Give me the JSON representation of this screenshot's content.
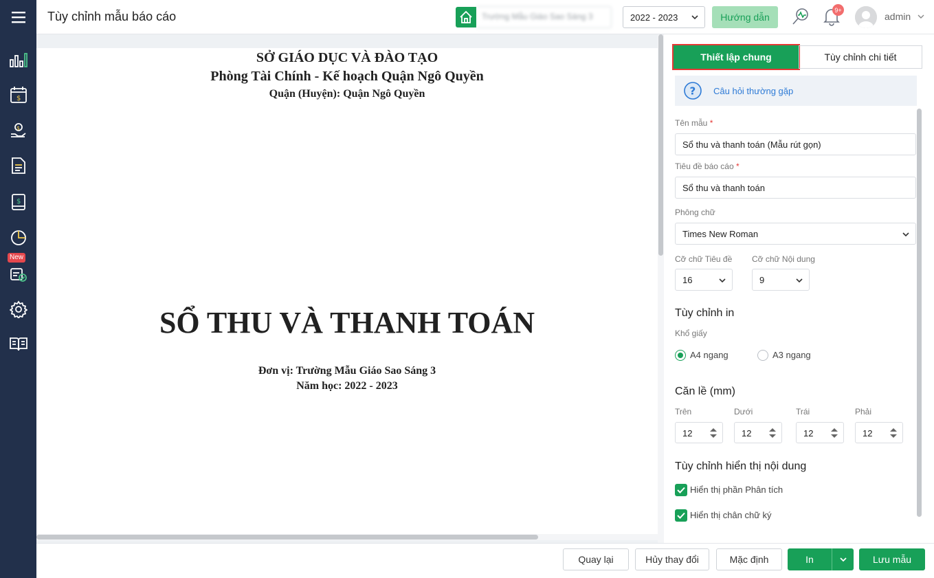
{
  "header": {
    "title": "Tùy chỉnh mẫu báo cáo",
    "school_value": "Trường Mẫu Giáo Sao Sáng 3",
    "year": "2022 - 2023",
    "guide_label": "Hướng dẫn",
    "notification_badge": "9+",
    "user_name": "admin"
  },
  "sidebar": {
    "new_badge": "New",
    "items": [
      "dashboard",
      "fee-calendar",
      "collection",
      "document",
      "finance-book",
      "report",
      "new-feature",
      "settings",
      "guide-book"
    ]
  },
  "preview": {
    "org_line1": "SỞ GIÁO DỤC VÀ ĐÀO TẠO",
    "org_line2": "Phòng Tài Chính - Kế hoạch Quận Ngô Quyền",
    "org_line3": "Quận (Huyện): Quận Ngô Quyền",
    "report_title": "SỔ THU VÀ THANH TOÁN",
    "unit_line": "Đơn vị: Trường Mẫu Giáo Sao Sáng 3",
    "year_line": "Năm học: 2022 - 2023"
  },
  "panel": {
    "tab_general": "Thiết lập chung",
    "tab_detail": "Tùy chỉnh chi tiết",
    "faq_label": "Câu hỏi thường gặp",
    "template_name_label": "Tên mẫu",
    "template_name_value": "Sổ thu và thanh toán (Mẫu rút gọn)",
    "report_title_label": "Tiêu đề báo cáo",
    "report_title_value": "Sổ thu và thanh toán",
    "required_mark": "*",
    "font_label": "Phông chữ",
    "font_value": "Times New Roman",
    "title_size_label": "Cỡ chữ Tiêu đề",
    "title_size_value": "16",
    "content_size_label": "Cỡ chữ Nội dung",
    "content_size_value": "9",
    "print_section": "Tùy chỉnh in",
    "paper_label": "Khổ giấy",
    "paper_options": [
      "A4 ngang",
      "A3 ngang"
    ],
    "paper_selected": "A4 ngang",
    "margin_section": "Căn lề (mm)",
    "margin_top_label": "Trên",
    "margin_top": "12",
    "margin_bottom_label": "Dưới",
    "margin_bottom": "12",
    "margin_left_label": "Trái",
    "margin_left": "12",
    "margin_right_label": "Phải",
    "margin_right": "12",
    "display_section": "Tùy chỉnh hiển thị nội dung",
    "show_analysis_label": "Hiển thị phần Phân tích",
    "show_analysis": true,
    "show_signature_label": "Hiển thị chân chữ ký",
    "show_signature": true
  },
  "footer": {
    "back_label": "Quay lại",
    "discard_label": "Hủy thay đổi",
    "default_label": "Mặc định",
    "print_label": "In",
    "save_label": "Lưu mẫu"
  },
  "colors": {
    "sidebar_bg": "#22304b",
    "accent_green": "#18a058",
    "highlight_red": "#e53935",
    "link_blue": "#2d7ad6"
  }
}
